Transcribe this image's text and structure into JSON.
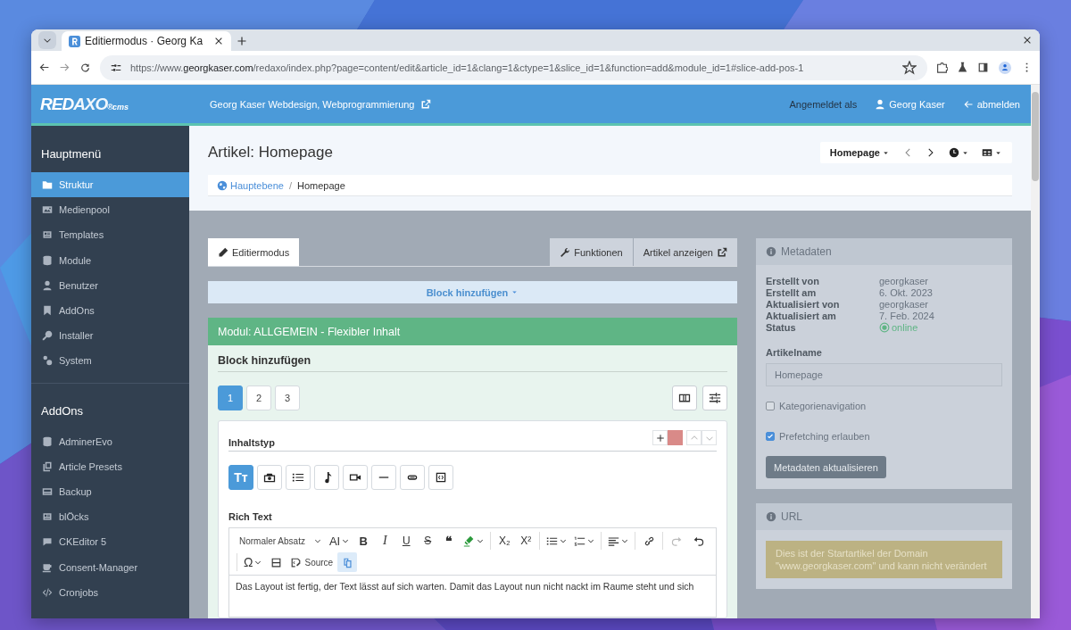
{
  "browser": {
    "tab_title": "Editiermodus · Georg Ka",
    "url": {
      "scheme": "https://www.",
      "host": "georgkaser.com",
      "path": "/redaxo/index.php?page=content/edit&article_id=1&clang=1&ctype=1&slice_id=1&function=add&module_id=1#slice-add-pos-1"
    }
  },
  "header": {
    "logo": {
      "left": "RED",
      "right": "AXO",
      "mark": "®",
      "suffix": "cms"
    },
    "site_link": "Georg Kaser Webdesign, Webprogrammierung",
    "logged_in_label": "Angemeldet als",
    "user": "Georg Kaser",
    "logout": "abmelden"
  },
  "sidebar": {
    "sections": [
      {
        "title": "Hauptmenü",
        "items": [
          {
            "label": "Struktur",
            "selected": true
          },
          {
            "label": "Medienpool",
            "selected": false
          },
          {
            "label": "Templates",
            "selected": false
          },
          {
            "label": "Module",
            "selected": false
          },
          {
            "label": "Benutzer",
            "selected": false
          },
          {
            "label": "AddOns",
            "selected": false
          },
          {
            "label": "Installer",
            "selected": false
          },
          {
            "label": "System",
            "selected": false
          }
        ]
      },
      {
        "title": "AddOns",
        "items": [
          {
            "label": "AdminerEvo",
            "selected": false
          },
          {
            "label": "Article Presets",
            "selected": false
          },
          {
            "label": "Backup",
            "selected": false
          },
          {
            "label": "blÖcks",
            "selected": false
          },
          {
            "label": "CKEditor 5",
            "selected": false
          },
          {
            "label": "Consent-Manager",
            "selected": false
          },
          {
            "label": "Cronjobs",
            "selected": false
          }
        ]
      }
    ]
  },
  "page": {
    "title": "Artikel: Homepage",
    "article_menu": "Homepage",
    "breadcrumb": {
      "root": "Hauptebene",
      "separator": "/",
      "current": "Homepage"
    }
  },
  "tabs_left": [
    {
      "label": "Editiermodus",
      "selected": true
    }
  ],
  "tabs_right": [
    {
      "label": "Funktionen",
      "selected": false
    },
    {
      "label": "Artikel anzeigen",
      "selected": false
    }
  ],
  "add_block": "Block hinzufügen",
  "module": {
    "title": "Modul: ALLGEMEIN - Flexibler Inhalt",
    "heading": "Block hinzufügen",
    "pages": [
      {
        "label": "1",
        "selected": true
      },
      {
        "label": "2",
        "selected": false
      },
      {
        "label": "3",
        "selected": false
      }
    ],
    "content_type_label": "Inhaltstyp",
    "content_types": [
      {
        "glyph": "Tт",
        "selected": true
      },
      {
        "selected": false
      },
      {
        "selected": false
      },
      {
        "selected": false
      },
      {
        "selected": false
      },
      {
        "selected": false
      },
      {
        "selected": false
      },
      {
        "selected": false
      }
    ],
    "field_label": "Rich Text",
    "editor": {
      "paragraph_format": "Normaler Absatz",
      "glyphs": [
        "AI",
        "B",
        "I",
        "U",
        "S",
        "❝",
        "X₂",
        "X²",
        "Ω"
      ],
      "source_label": "Source",
      "text": "Das Layout ist fertig, der Text lässt auf sich warten. Damit das Layout nun nicht nackt im Raume steht und sich"
    }
  },
  "metadata": {
    "title": "Metadaten",
    "rows": [
      {
        "label": "Erstellt von",
        "value": "georgkaser"
      },
      {
        "label": "Erstellt am",
        "value": "6. Okt. 2023"
      },
      {
        "label": "Aktualisiert von",
        "value": "georgkaser"
      },
      {
        "label": "Aktualisiert am",
        "value": "7. Feb. 2024"
      },
      {
        "label": "Status",
        "value": "online",
        "kind": "status"
      }
    ],
    "name_label": "Artikelname",
    "name_value": "Homepage",
    "checkboxes": [
      {
        "label": "Kategorienavigation",
        "checked": false
      },
      {
        "label": "Prefetching erlauben",
        "checked": true
      }
    ],
    "button": "Metadaten aktualisieren"
  },
  "url_panel": {
    "title": "URL",
    "notice": [
      "Dies ist der Startartikel der Domain",
      "\"www.georgkaser.com\" und kann nicht verändert"
    ]
  }
}
